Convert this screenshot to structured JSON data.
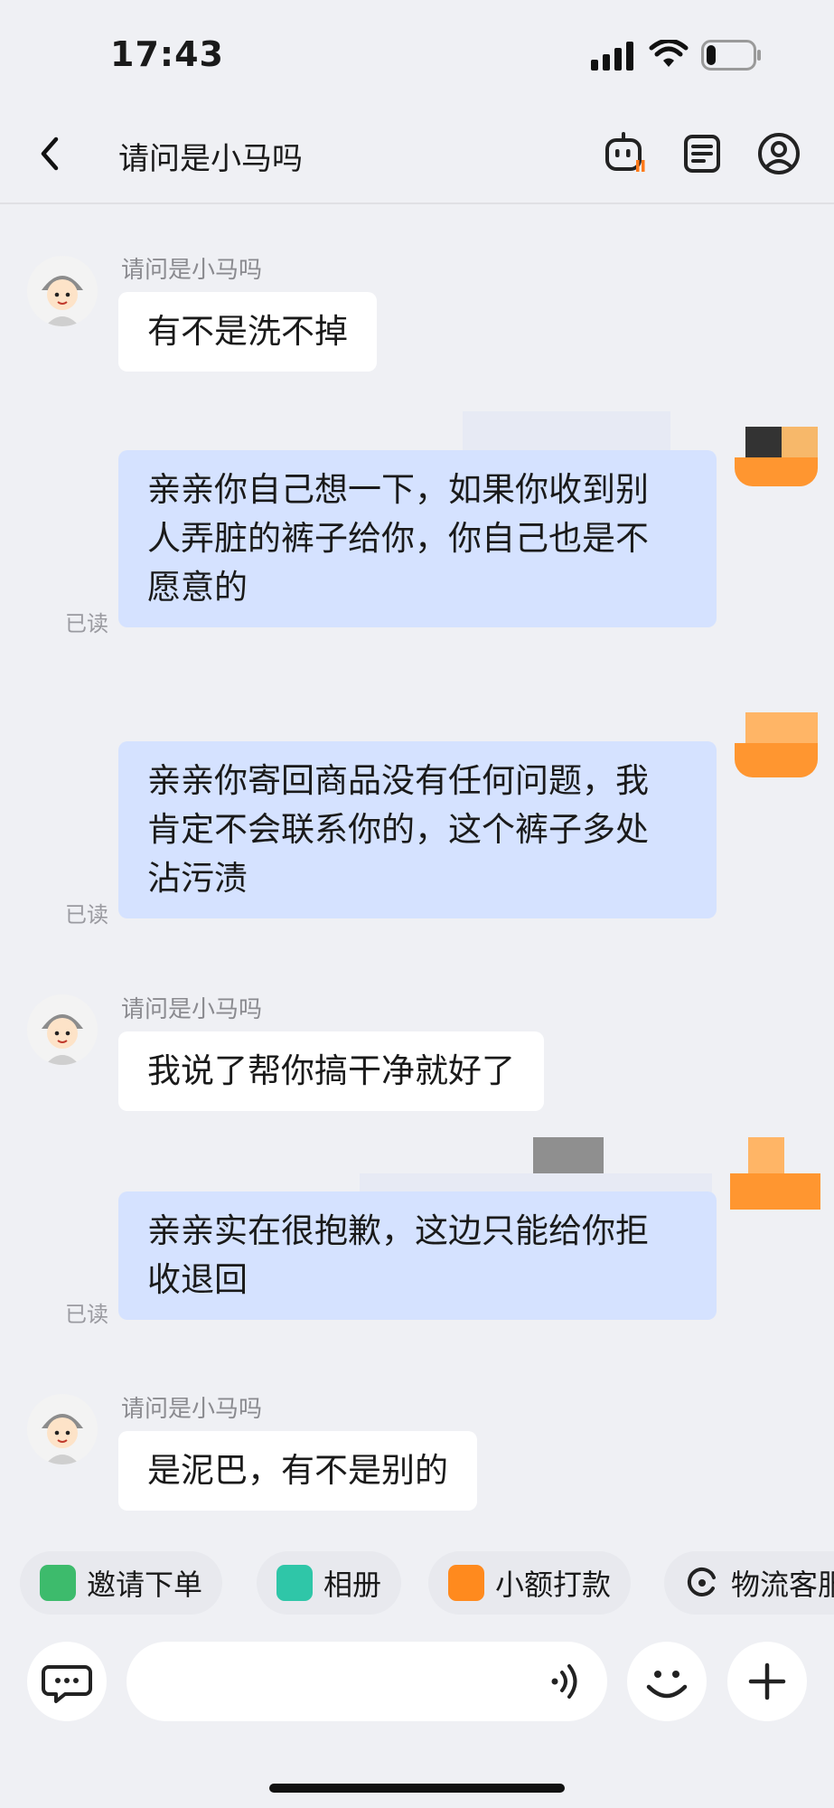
{
  "status_bar": {
    "time": "17:43",
    "battery_level": 0.2
  },
  "header": {
    "title": "请问是小马吗"
  },
  "icons": {
    "back": "chevron-left-icon",
    "bot": "robot-icon",
    "notes": "document-icon",
    "profile": "user-circle-icon"
  },
  "messages": [
    {
      "direction": "in",
      "sender": "请问是小马吗",
      "text": "有不是洗不掉"
    },
    {
      "direction": "out",
      "status": "已读",
      "text": "亲亲你自己想一下，如果你收到别人弄脏的裤子给你，你自己也是不愿意的",
      "lines": [
        "亲亲你自己想一下，如果你收到别",
        "人弄脏的裤子给你，你自己也是不",
        "愿意的"
      ]
    },
    {
      "direction": "out",
      "status": "已读",
      "text": "亲亲你寄回商品没有任何问题，我肯定不会联系你的，这个裤子多处沾污渍",
      "lines": [
        "亲亲你寄回商品没有任何问题，我",
        "肯定不会联系你的，这个裤子多处",
        "沾污渍"
      ]
    },
    {
      "direction": "in",
      "sender": "请问是小马吗",
      "text": "我说了帮你搞干净就好了"
    },
    {
      "direction": "out",
      "status": "已读",
      "text": "亲亲实在很抱歉，这边只能给你拒收退回",
      "lines": [
        "亲亲实在很抱歉，这边只能给你拒",
        "收退回"
      ]
    },
    {
      "direction": "in",
      "sender": "请问是小马吗",
      "text": "是泥巴，有不是别的"
    }
  ],
  "quick_actions": [
    {
      "label": "邀请下单",
      "icon": "invite-order-icon",
      "color": "#3dbb6c"
    },
    {
      "label": "相册",
      "icon": "photo-album-icon",
      "color": "#2fc6a8"
    },
    {
      "label": "小额打款",
      "icon": "payment-icon",
      "color": "#ff8a1e"
    },
    {
      "label": "物流客服",
      "icon": "logistics-service-icon",
      "color": "#222222"
    }
  ],
  "input_bar": {
    "left_icon": "chat-bubble-icon",
    "voice_icon": "voice-wave-icon",
    "emoji_icon": "smiley-icon",
    "add_icon": "plus-icon"
  }
}
